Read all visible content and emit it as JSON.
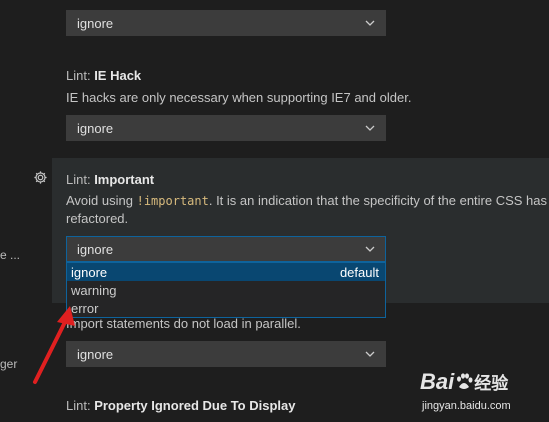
{
  "left_fragments": {
    "ellipsis": "e ...",
    "ger": "ger"
  },
  "top_setting": {
    "value": "ignore"
  },
  "ie_hack": {
    "category": "Lint: ",
    "name": "IE Hack",
    "description": "IE hacks are only necessary when supporting IE7 and older.",
    "value": "ignore"
  },
  "important": {
    "category": "Lint: ",
    "name": "Important",
    "desc_before": "Avoid using ",
    "desc_code": "!important",
    "desc_after": ". It is an indication that the specificity of the entire CSS has g",
    "desc_line2": "refactored.",
    "value": "ignore",
    "options": [
      {
        "label": "ignore",
        "tag": "default"
      },
      {
        "label": "warning",
        "tag": ""
      },
      {
        "label": "error",
        "tag": ""
      }
    ]
  },
  "import_setting": {
    "description": "Import statements do not load in parallel.",
    "value": "ignore"
  },
  "property_ignored": {
    "category": "Lint: ",
    "name": "Property Ignored Due To Display"
  },
  "watermark": {
    "brand": "Bai",
    "brand_suffix": "经验",
    "url": "jingyan.baidu.com"
  },
  "colors": {
    "background": "#1e1e1e",
    "highlight": "#2a2d2e",
    "select_bg": "#3c3c3c",
    "focus_border": "#0e639c",
    "selected_option": "#094771",
    "arrow": "#e02020"
  }
}
